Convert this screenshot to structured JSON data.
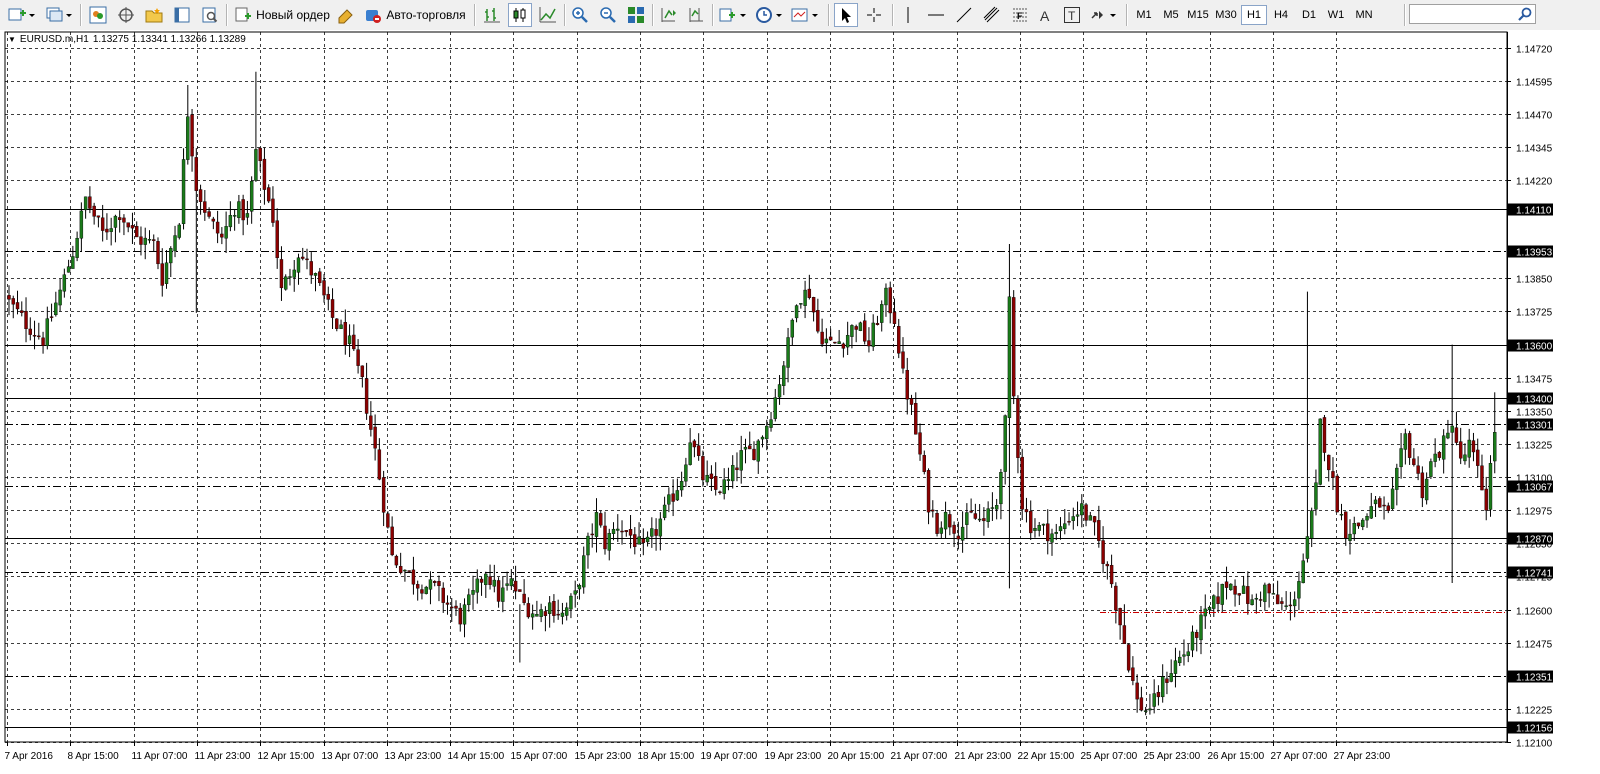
{
  "toolbar": {
    "new_order": "Новый ордер",
    "autotrading": "Авто-торговля",
    "timeframes": [
      {
        "label": "M1",
        "active": false
      },
      {
        "label": "M5",
        "active": false
      },
      {
        "label": "M15",
        "active": false
      },
      {
        "label": "M30",
        "active": false
      },
      {
        "label": "H1",
        "active": true
      },
      {
        "label": "H4",
        "active": false
      },
      {
        "label": "D1",
        "active": false
      },
      {
        "label": "W1",
        "active": false
      },
      {
        "label": "MN",
        "active": false
      }
    ],
    "search_value": ""
  },
  "symbol_info": {
    "symbol": "EURUSD.m,H1",
    "ohlc": "1.13275 1.13341 1.13266 1.13289"
  },
  "colors": {
    "bull": "#1a7a1a",
    "bear": "#8b0000",
    "grid": "#bfbfbf",
    "level": "#000000",
    "bid_line": "#cc0000"
  },
  "chart_data": {
    "type": "candlestick",
    "ylim": [
      1.121,
      1.1478
    ],
    "y_ticks": [
      "1.14720",
      "1.14595",
      "1.14470",
      "1.14345",
      "1.14220",
      "1.13850",
      "1.13725",
      "1.13475",
      "1.13350",
      "1.13225",
      "1.13100",
      "1.12975",
      "1.12850",
      "1.12725",
      "1.12600",
      "1.12475",
      "1.12225",
      "1.12100"
    ],
    "x_ticks": [
      "7 Apr 2016",
      "8 Apr 15:00",
      "11 Apr 07:00",
      "11 Apr 23:00",
      "12 Apr 15:00",
      "13 Apr 07:00",
      "13 Apr 23:00",
      "14 Apr 15:00",
      "15 Apr 07:00",
      "15 Apr 23:00",
      "18 Apr 15:00",
      "19 Apr 07:00",
      "19 Apr 23:00",
      "20 Apr 15:00",
      "21 Apr 07:00",
      "21 Apr 23:00",
      "22 Apr 15:00",
      "25 Apr 07:00",
      "25 Apr 23:00",
      "26 Apr 15:00",
      "27 Apr 07:00",
      "27 Apr 23:00"
    ],
    "levels": [
      {
        "price": 1.1411,
        "label": "1.14110",
        "style": "solid"
      },
      {
        "price": 1.13953,
        "label": "1.13953",
        "style": "dashdot"
      },
      {
        "price": 1.136,
        "label": "1.13600",
        "style": "solid"
      },
      {
        "price": 1.134,
        "label": "1.13400",
        "style": "solid"
      },
      {
        "price": 1.13301,
        "label": "1.13301",
        "style": "dashdot"
      },
      {
        "price": 1.13067,
        "label": "1.13067",
        "style": "dashdot"
      },
      {
        "price": 1.1287,
        "label": "1.12870",
        "style": "solid"
      },
      {
        "price": 1.12741,
        "label": "1.12741",
        "style": "dashdot"
      },
      {
        "price": 1.12351,
        "label": "1.12351",
        "style": "dashdot"
      },
      {
        "price": 1.12156,
        "label": "1.12156",
        "style": "solid"
      }
    ],
    "bid_price": 1.1259,
    "anchors": [
      [
        0,
        1.1376
      ],
      [
        4,
        1.1368
      ],
      [
        8,
        1.1362
      ],
      [
        12,
        1.138
      ],
      [
        15,
        1.1395
      ],
      [
        18,
        1.1415
      ],
      [
        22,
        1.1402
      ],
      [
        26,
        1.141
      ],
      [
        30,
        1.14
      ],
      [
        34,
        1.1398
      ],
      [
        36,
        1.1385
      ],
      [
        40,
        1.1408
      ],
      [
        42,
        1.1448
      ],
      [
        44,
        1.142
      ],
      [
        47,
        1.1407
      ],
      [
        50,
        1.14
      ],
      [
        53,
        1.1412
      ],
      [
        56,
        1.1408
      ],
      [
        58,
        1.1433
      ],
      [
        60,
        1.142
      ],
      [
        62,
        1.1408
      ],
      [
        64,
        1.138
      ],
      [
        68,
        1.1395
      ],
      [
        72,
        1.1385
      ],
      [
        76,
        1.137
      ],
      [
        80,
        1.136
      ],
      [
        83,
        1.1345
      ],
      [
        86,
        1.132
      ],
      [
        88,
        1.13
      ],
      [
        90,
        1.128
      ],
      [
        93,
        1.1275
      ],
      [
        96,
        1.127
      ],
      [
        100,
        1.1268
      ],
      [
        103,
        1.1262
      ],
      [
        106,
        1.1257
      ],
      [
        109,
        1.1265
      ],
      [
        112,
        1.1275
      ],
      [
        115,
        1.1265
      ],
      [
        118,
        1.127
      ],
      [
        121,
        1.1262
      ],
      [
        124,
        1.1258
      ],
      [
        127,
        1.1262
      ],
      [
        130,
        1.1258
      ],
      [
        133,
        1.1265
      ],
      [
        136,
        1.1285
      ],
      [
        138,
        1.1295
      ],
      [
        140,
        1.1285
      ],
      [
        143,
        1.1292
      ],
      [
        146,
        1.1288
      ],
      [
        149,
        1.1282
      ],
      [
        152,
        1.129
      ],
      [
        155,
        1.13
      ],
      [
        158,
        1.131
      ],
      [
        160,
        1.1325
      ],
      [
        163,
        1.131
      ],
      [
        166,
        1.1305
      ],
      [
        169,
        1.1308
      ],
      [
        172,
        1.1318
      ],
      [
        175,
        1.132
      ],
      [
        178,
        1.133
      ],
      [
        180,
        1.134
      ],
      [
        183,
        1.136
      ],
      [
        185,
        1.1378
      ],
      [
        188,
        1.138
      ],
      [
        190,
        1.1365
      ],
      [
        193,
        1.136
      ],
      [
        196,
        1.1362
      ],
      [
        199,
        1.1368
      ],
      [
        202,
        1.136
      ],
      [
        204,
        1.137
      ],
      [
        206,
        1.1378
      ],
      [
        208,
        1.137
      ],
      [
        210,
        1.1348
      ],
      [
        212,
        1.1335
      ],
      [
        214,
        1.1318
      ],
      [
        216,
        1.13
      ],
      [
        218,
        1.1292
      ],
      [
        220,
        1.1295
      ],
      [
        223,
        1.129
      ],
      [
        226,
        1.1295
      ],
      [
        229,
        1.1293
      ],
      [
        232,
        1.13
      ],
      [
        234,
        1.133
      ],
      [
        235,
        1.1375
      ],
      [
        236,
        1.134
      ],
      [
        238,
        1.13
      ],
      [
        240,
        1.1292
      ],
      [
        243,
        1.129
      ],
      [
        246,
        1.1288
      ],
      [
        249,
        1.1295
      ],
      [
        252,
        1.1298
      ],
      [
        255,
        1.129
      ],
      [
        257,
        1.128
      ],
      [
        259,
        1.127
      ],
      [
        261,
        1.1255
      ],
      [
        263,
        1.124
      ],
      [
        265,
        1.1225
      ],
      [
        267,
        1.1222
      ],
      [
        269,
        1.1225
      ],
      [
        271,
        1.1232
      ],
      [
        274,
        1.124
      ],
      [
        277,
        1.1245
      ],
      [
        280,
        1.1255
      ],
      [
        283,
        1.1262
      ],
      [
        286,
        1.127
      ],
      [
        289,
        1.1268
      ],
      [
        292,
        1.1262
      ],
      [
        295,
        1.1268
      ],
      [
        298,
        1.1262
      ],
      [
        301,
        1.126
      ],
      [
        303,
        1.1272
      ],
      [
        305,
        1.1285
      ],
      [
        307,
        1.1305
      ],
      [
        308,
        1.133
      ],
      [
        310,
        1.1315
      ],
      [
        312,
        1.13
      ],
      [
        314,
        1.129
      ],
      [
        317,
        1.1292
      ],
      [
        320,
        1.1298
      ],
      [
        322,
        1.13
      ],
      [
        324,
        1.1295
      ],
      [
        326,
        1.131
      ],
      [
        328,
        1.1325
      ],
      [
        330,
        1.1315
      ],
      [
        332,
        1.1305
      ],
      [
        334,
        1.1315
      ],
      [
        336,
        1.132
      ],
      [
        338,
        1.1325
      ],
      [
        339,
        1.1332
      ],
      [
        341,
        1.1315
      ],
      [
        343,
        1.1322
      ],
      [
        345,
        1.1312
      ],
      [
        347,
        1.13
      ],
      [
        349,
        1.1328
      ]
    ]
  }
}
